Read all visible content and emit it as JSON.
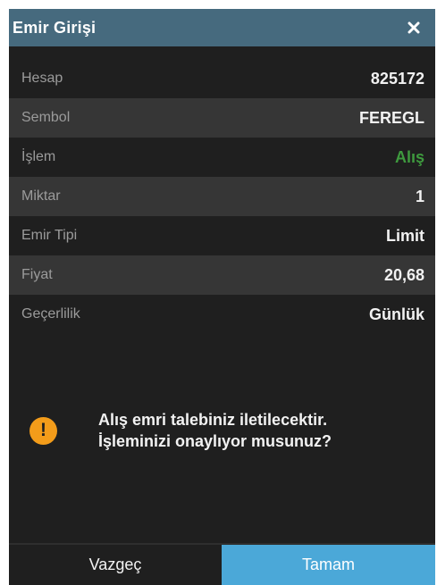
{
  "dialog": {
    "title": "Emir Girişi",
    "close_icon": "close-icon"
  },
  "order": {
    "rows": [
      {
        "label": "Hesap",
        "value": "825172"
      },
      {
        "label": "Sembol",
        "value": "FEREGL"
      },
      {
        "label": "İşlem",
        "value": "Alış"
      },
      {
        "label": "Miktar",
        "value": "1"
      },
      {
        "label": "Emir Tipi",
        "value": "Limit"
      },
      {
        "label": "Fiyat",
        "value": "20,68"
      },
      {
        "label": "Geçerlilik",
        "value": "Günlük"
      }
    ]
  },
  "confirmation": {
    "icon": "warning-icon",
    "line1": "Alış emri talebiniz iletilecektir.",
    "line2": "İşleminizi onaylıyor musunuz?"
  },
  "buttons": {
    "cancel_label": "Vazgeç",
    "ok_label": "Tamam"
  },
  "colors": {
    "title_bar": "#466a7e",
    "buy": "#3e9a3e",
    "warning": "#f39c1a",
    "primary_button": "#4ba8d8"
  }
}
